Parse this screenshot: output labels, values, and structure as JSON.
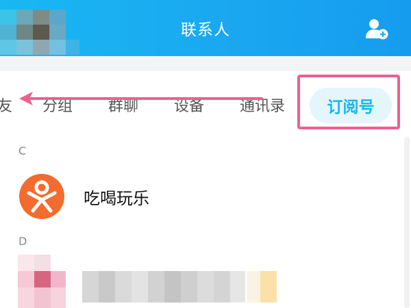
{
  "header": {
    "title": "联系人",
    "background": "#19b8f2",
    "left_icon": "blurred-avatar",
    "right_icon": "add-contact-icon"
  },
  "tabs": [
    {
      "label": "友",
      "active": false
    },
    {
      "label": "分组",
      "active": false
    },
    {
      "label": "群聊",
      "active": false
    },
    {
      "label": "设备",
      "active": false
    },
    {
      "label": "通讯录",
      "active": false
    },
    {
      "label": "订阅号",
      "active": true
    }
  ],
  "annotation": {
    "highlight_color": "#ee5f8e",
    "arrow_direction": "left"
  },
  "sections": [
    {
      "letter": "C",
      "items": [
        {
          "name": "吃喝玩乐",
          "avatar_color": "#f36c2f"
        }
      ]
    },
    {
      "letter": "D",
      "items": [
        {
          "name": "",
          "blurred": true
        }
      ]
    }
  ]
}
